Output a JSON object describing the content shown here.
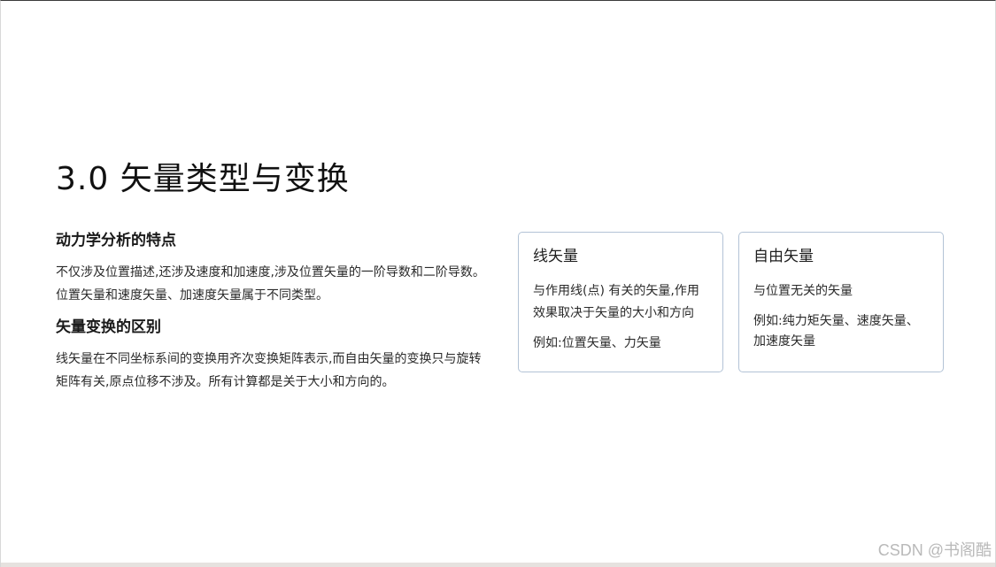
{
  "slide": {
    "title": "3.0 矢量类型与变换"
  },
  "left": {
    "section1": {
      "heading": "动力学分析的特点",
      "body": "不仅涉及位置描述,还涉及速度和加速度,涉及位置矢量的一阶导数和二阶导数。位置矢量和速度矢量、加速度矢量属于不同类型。"
    },
    "section2": {
      "heading": "矢量变换的区别",
      "body": "线矢量在不同坐标系间的变换用齐次变换矩阵表示,而自由矢量的变换只与旋转矩阵有关,原点位移不涉及。所有计算都是关于大小和方向的。"
    }
  },
  "cards": [
    {
      "title": "线矢量",
      "description": "与作用线(点) 有关的矢量,作用效果取决于矢量的大小和方向",
      "example": "例如:位置矢量、力矢量"
    },
    {
      "title": "自由矢量",
      "description": "与位置无关的矢量",
      "example": "例如:纯力矩矢量、速度矢量、加速度矢量"
    }
  ],
  "watermark": "CSDN @书阁酷",
  "colors": {
    "card_border": "#b3c3d6",
    "text": "#222222",
    "watermark": "#b9b9b9"
  }
}
